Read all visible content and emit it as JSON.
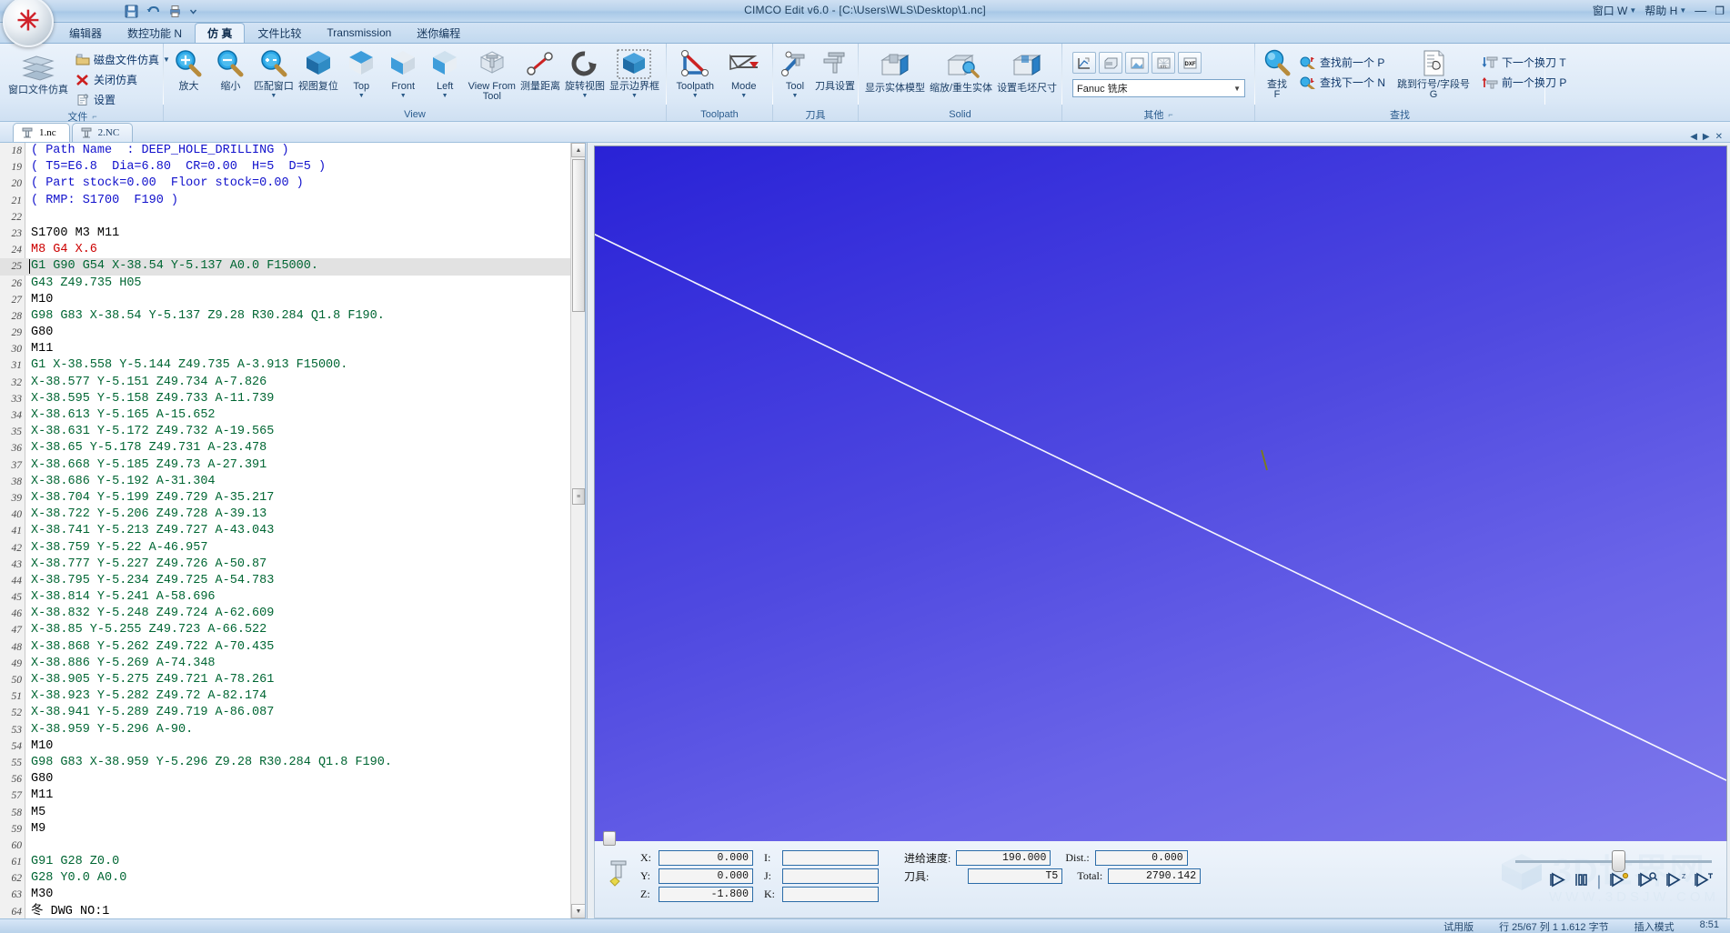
{
  "window": {
    "title": "CIMCO Edit v6.0 - [C:\\Users\\WLS\\Desktop\\1.nc]",
    "menu_window": "窗口 W",
    "menu_help": "帮助 H",
    "minimize": "—",
    "restore": "❐"
  },
  "quick_access": [
    "save-icon",
    "undo-icon",
    "print-icon",
    "customize-icon"
  ],
  "ribbon_tabs": [
    {
      "label": "编辑器",
      "active": false
    },
    {
      "label": "数控功能 N",
      "active": false
    },
    {
      "label": "仿 真",
      "active": true
    },
    {
      "label": "文件比较",
      "active": false
    },
    {
      "label": "Transmission",
      "active": false
    },
    {
      "label": "迷你编程",
      "active": false
    }
  ],
  "ribbon_groups": [
    {
      "name": "文件",
      "label": "文件",
      "has_dialog_launcher": true,
      "big": [
        {
          "label": "窗口文件仿真",
          "label2": "",
          "dropdown": false,
          "icon": "window-sim-icon"
        }
      ],
      "small": [
        {
          "label": "磁盘文件仿真",
          "icon": "disk-sim-icon",
          "dropdown": true
        },
        {
          "label": "关闭仿真",
          "icon": "close-sim-icon",
          "dropdown": false
        },
        {
          "label": "设置",
          "icon": "settings-icon",
          "dropdown": false
        }
      ]
    },
    {
      "name": "view",
      "label": "View",
      "has_dialog_launcher": false,
      "big": [
        {
          "label": "放大",
          "label2": "",
          "dropdown": false,
          "icon": "zoom-in-icon"
        },
        {
          "label": "缩小",
          "label2": "",
          "dropdown": false,
          "icon": "zoom-out-icon"
        },
        {
          "label": "匹配窗口",
          "label2": "",
          "dropdown": true,
          "icon": "zoom-fit-icon"
        },
        {
          "label": "视图复位",
          "label2": "",
          "dropdown": false,
          "icon": "view-reset-cube-icon"
        },
        {
          "label": "Top",
          "label2": "",
          "dropdown": true,
          "icon": "view-top-cube-icon"
        },
        {
          "label": "Front",
          "label2": "",
          "dropdown": true,
          "icon": "view-front-cube-icon"
        },
        {
          "label": "Left",
          "label2": "",
          "dropdown": true,
          "icon": "view-left-cube-icon"
        },
        {
          "label": "View From",
          "label2": "Tool",
          "dropdown": false,
          "icon": "view-from-tool-icon"
        },
        {
          "label": "测量距离",
          "label2": "",
          "dropdown": false,
          "icon": "measure-distance-icon"
        },
        {
          "label": "旋转视图",
          "label2": "",
          "dropdown": true,
          "icon": "rotate-view-icon"
        },
        {
          "label": "显示边界框",
          "label2": "",
          "dropdown": true,
          "icon": "bounding-box-icon"
        }
      ],
      "small": []
    },
    {
      "name": "toolpath",
      "label": "Toolpath",
      "has_dialog_launcher": false,
      "big": [
        {
          "label": "Toolpath",
          "label2": "",
          "dropdown": true,
          "icon": "toolpath-icon"
        },
        {
          "label": "Mode",
          "label2": "",
          "dropdown": true,
          "icon": "toolpath-mode-icon"
        }
      ],
      "small": []
    },
    {
      "name": "tool",
      "label": "刀具",
      "has_dialog_launcher": false,
      "big": [
        {
          "label": "Tool",
          "label2": "",
          "dropdown": true,
          "icon": "tool-icon"
        },
        {
          "label": "刀具设置",
          "label2": "",
          "dropdown": false,
          "icon": "tool-setup-icon"
        }
      ],
      "small": []
    },
    {
      "name": "solid",
      "label": "Solid",
      "has_dialog_launcher": false,
      "big": [
        {
          "label": "显示实体模型",
          "label2": "",
          "dropdown": false,
          "icon": "show-solid-icon"
        },
        {
          "label": "缩放/重生实体",
          "label2": "",
          "dropdown": false,
          "icon": "rescale-solid-icon"
        },
        {
          "label": "设置毛坯尺寸",
          "label2": "",
          "dropdown": false,
          "icon": "stock-size-icon"
        }
      ],
      "small": []
    },
    {
      "name": "other",
      "label": "其他",
      "has_dialog_launcher": true,
      "icon_buttons": [
        "plot-icon",
        "machine-icon",
        "export-image-icon",
        "stl-icon",
        "dxf-icon"
      ],
      "machine_value": "Fanuc 铣床",
      "big": [],
      "small": []
    },
    {
      "name": "find",
      "label": "查找",
      "has_dialog_launcher": false,
      "big": [
        {
          "label": "查找",
          "label2": "F",
          "dropdown": false,
          "icon": "find-icon"
        }
      ],
      "small": [
        {
          "label": "查找前一个 P",
          "icon": "find-prev-icon",
          "dropdown": false
        },
        {
          "label": "查找下一个 N",
          "icon": "find-next-icon",
          "dropdown": false
        }
      ],
      "big2": [
        {
          "label": "跳到行号/字段号",
          "label2": "G",
          "dropdown": false,
          "icon": "goto-line-icon"
        }
      ],
      "small2": [
        {
          "label": "下一个换刀 T",
          "icon": "next-toolchange-icon",
          "dropdown": false
        },
        {
          "label": "前一个换刀 P",
          "icon": "prev-toolchange-icon",
          "dropdown": false
        }
      ]
    }
  ],
  "doc_tabs": [
    {
      "label": "1.nc",
      "active": true,
      "icon": "nc-file-icon"
    },
    {
      "label": "2.NC",
      "active": false,
      "icon": "nc-file-icon"
    }
  ],
  "editor": {
    "first_line_number": 18,
    "current_line": 25,
    "lines": [
      {
        "n": 18,
        "text": "( Path Name  : DEEP_HOLE_DRILLING )",
        "style": "cmt"
      },
      {
        "n": 19,
        "text": "( T5=E6.8  Dia=6.80  CR=0.00  H=5  D=5 )",
        "style": "cmt"
      },
      {
        "n": 20,
        "text": "( Part stock=0.00  Floor stock=0.00 )",
        "style": "cmt"
      },
      {
        "n": 21,
        "text": "( RMP: S1700  F190 )",
        "style": "cmt"
      },
      {
        "n": 22,
        "text": "",
        "style": "code"
      },
      {
        "n": 23,
        "text": "S1700 M3 M11",
        "style": "mcode"
      },
      {
        "n": 24,
        "text": "M8 G4 X.6",
        "style": "red"
      },
      {
        "n": 25,
        "text": "G1 G90 G54 X-38.54 Y-5.137 A0.0 F15000.",
        "style": "code",
        "current": true
      },
      {
        "n": 26,
        "text": "G43 Z49.735 H05",
        "style": "code"
      },
      {
        "n": 27,
        "text": "M10",
        "style": "mcode"
      },
      {
        "n": 28,
        "text": "G98 G83 X-38.54 Y-5.137 Z9.28 R30.284 Q1.8 F190.",
        "style": "code"
      },
      {
        "n": 29,
        "text": "G80",
        "style": "mcode"
      },
      {
        "n": 30,
        "text": "M11",
        "style": "mcode"
      },
      {
        "n": 31,
        "text": "G1 X-38.558 Y-5.144 Z49.735 A-3.913 F15000.",
        "style": "code"
      },
      {
        "n": 32,
        "text": "X-38.577 Y-5.151 Z49.734 A-7.826",
        "style": "code"
      },
      {
        "n": 33,
        "text": "X-38.595 Y-5.158 Z49.733 A-11.739",
        "style": "code"
      },
      {
        "n": 34,
        "text": "X-38.613 Y-5.165 A-15.652",
        "style": "code"
      },
      {
        "n": 35,
        "text": "X-38.631 Y-5.172 Z49.732 A-19.565",
        "style": "code"
      },
      {
        "n": 36,
        "text": "X-38.65 Y-5.178 Z49.731 A-23.478",
        "style": "code"
      },
      {
        "n": 37,
        "text": "X-38.668 Y-5.185 Z49.73 A-27.391",
        "style": "code"
      },
      {
        "n": 38,
        "text": "X-38.686 Y-5.192 A-31.304",
        "style": "code"
      },
      {
        "n": 39,
        "text": "X-38.704 Y-5.199 Z49.729 A-35.217",
        "style": "code"
      },
      {
        "n": 40,
        "text": "X-38.722 Y-5.206 Z49.728 A-39.13",
        "style": "code"
      },
      {
        "n": 41,
        "text": "X-38.741 Y-5.213 Z49.727 A-43.043",
        "style": "code"
      },
      {
        "n": 42,
        "text": "X-38.759 Y-5.22 A-46.957",
        "style": "code"
      },
      {
        "n": 43,
        "text": "X-38.777 Y-5.227 Z49.726 A-50.87",
        "style": "code"
      },
      {
        "n": 44,
        "text": "X-38.795 Y-5.234 Z49.725 A-54.783",
        "style": "code"
      },
      {
        "n": 45,
        "text": "X-38.814 Y-5.241 A-58.696",
        "style": "code"
      },
      {
        "n": 46,
        "text": "X-38.832 Y-5.248 Z49.724 A-62.609",
        "style": "code"
      },
      {
        "n": 47,
        "text": "X-38.85 Y-5.255 Z49.723 A-66.522",
        "style": "code"
      },
      {
        "n": 48,
        "text": "X-38.868 Y-5.262 Z49.722 A-70.435",
        "style": "code"
      },
      {
        "n": 49,
        "text": "X-38.886 Y-5.269 A-74.348",
        "style": "code"
      },
      {
        "n": 50,
        "text": "X-38.905 Y-5.275 Z49.721 A-78.261",
        "style": "code"
      },
      {
        "n": 51,
        "text": "X-38.923 Y-5.282 Z49.72 A-82.174",
        "style": "code"
      },
      {
        "n": 52,
        "text": "X-38.941 Y-5.289 Z49.719 A-86.087",
        "style": "code"
      },
      {
        "n": 53,
        "text": "X-38.959 Y-5.296 A-90.",
        "style": "code"
      },
      {
        "n": 54,
        "text": "M10",
        "style": "mcode"
      },
      {
        "n": 55,
        "text": "G98 G83 X-38.959 Y-5.296 Z9.28 R30.284 Q1.8 F190.",
        "style": "code"
      },
      {
        "n": 56,
        "text": "G80",
        "style": "mcode"
      },
      {
        "n": 57,
        "text": "M11",
        "style": "mcode"
      },
      {
        "n": 58,
        "text": "M5",
        "style": "mcode"
      },
      {
        "n": 59,
        "text": "M9",
        "style": "mcode"
      },
      {
        "n": 60,
        "text": "",
        "style": "code"
      },
      {
        "n": 61,
        "text": "G91 G28 Z0.0",
        "style": "code"
      },
      {
        "n": 62,
        "text": "G28 Y0.0 A0.0",
        "style": "code"
      },
      {
        "n": 63,
        "text": "M30",
        "style": "mcode"
      },
      {
        "n": 64,
        "text": "冬 DWG NO:1",
        "style": "mcode"
      }
    ]
  },
  "sim_status": {
    "coords": [
      {
        "label": "X:",
        "value": "0.000"
      },
      {
        "label": "Y:",
        "value": "0.000"
      },
      {
        "label": "Z:",
        "value": "-1.800"
      }
    ],
    "ijk": [
      {
        "label": "I:",
        "value": ""
      },
      {
        "label": "J:",
        "value": ""
      },
      {
        "label": "K:",
        "value": ""
      }
    ],
    "feed_label": "进给速度:",
    "feed_value": "190.000",
    "tool_label": "刀具:",
    "tool_value": "T5",
    "dist_label": "Dist.:",
    "dist_value": "0.000",
    "total_label": "Total:",
    "total_value": "2790.142"
  },
  "playback": {
    "buttons": [
      {
        "name": "play-button",
        "glyph": "▶"
      },
      {
        "name": "pause-button",
        "glyph": "❙❙"
      },
      {
        "name": "step-block-button",
        "glyph": "▶"
      },
      {
        "name": "step-search-button",
        "glyph": "▶"
      },
      {
        "name": "step-z-button",
        "glyph": "▶"
      },
      {
        "name": "step-tool-button",
        "glyph": "▶"
      }
    ],
    "slider_position_percent": 49
  },
  "watermark": {
    "main": "3D世界网",
    "sub": "WWW.3DSJW.COM"
  },
  "statusbar": {
    "items": [
      "试用版",
      "行 25/67 列 1 1.612 字节",
      "插入模式",
      "8:51"
    ]
  },
  "colors": {
    "accent": "#2b6ca8",
    "comment": "#1111cc",
    "gcode": "#006633",
    "mcode": "#000000",
    "alert": "#cc0000",
    "viewport_bg": "#4f49e0",
    "toolpath_line": "#ffffff",
    "tool_marker": "#7a7a22"
  }
}
